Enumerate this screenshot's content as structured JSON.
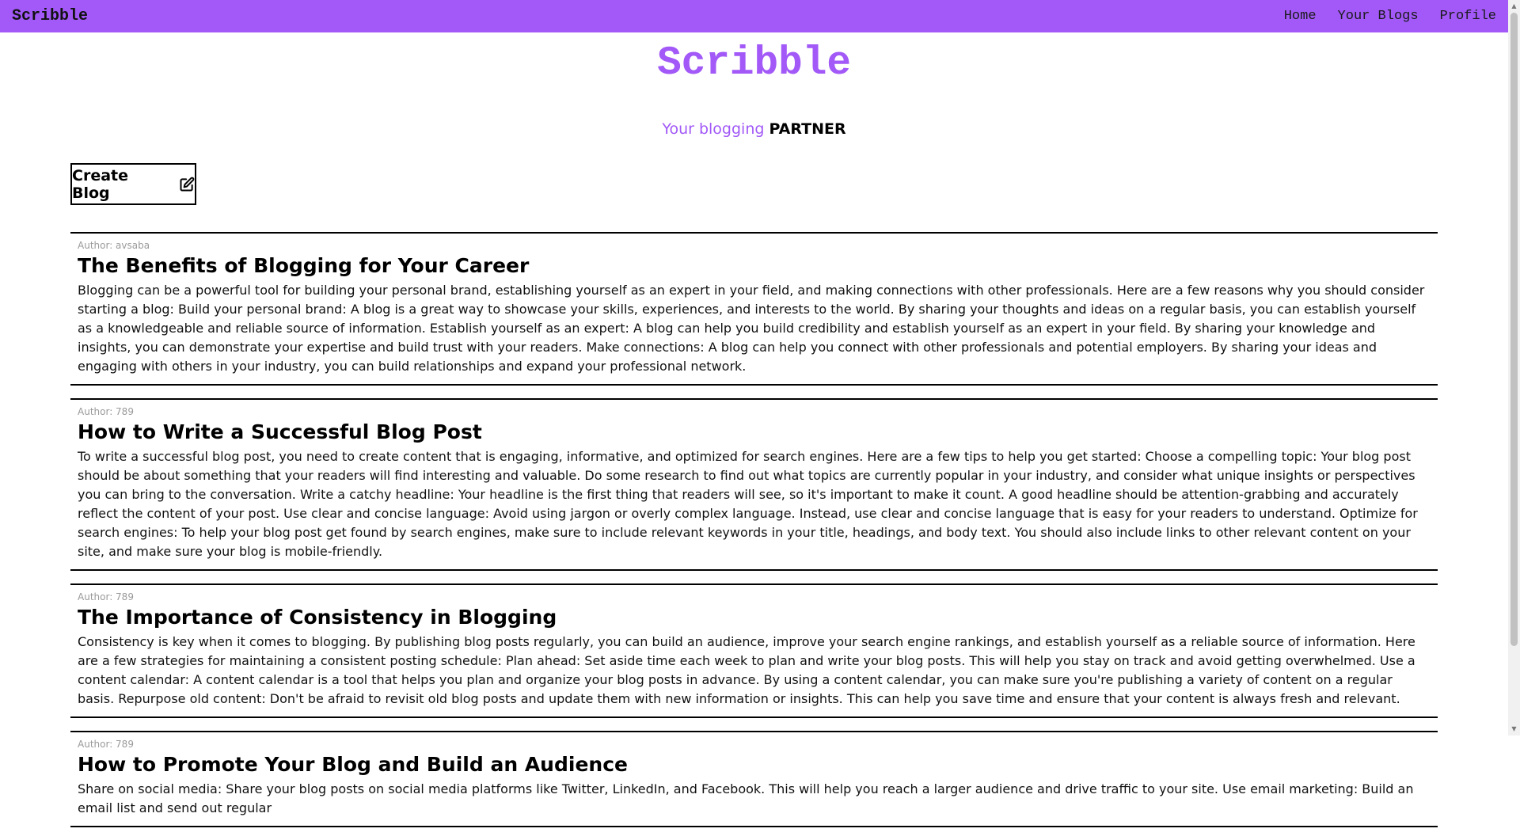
{
  "navbar": {
    "brand": "Scribble",
    "links": [
      {
        "label": "Home"
      },
      {
        "label": "Your Blogs"
      },
      {
        "label": "Profile"
      }
    ]
  },
  "hero": {
    "title": "Scribble",
    "tagline_light": "Your blogging",
    "tagline_strong": "PARTNER"
  },
  "create_button": {
    "label": "Create Blog",
    "icon": "edit-icon"
  },
  "blogs": [
    {
      "author": "Author: avsaba",
      "title": "The Benefits of Blogging for Your Career",
      "body": "Blogging can be a powerful tool for building your personal brand, establishing yourself as an expert in your field, and making connections with other professionals. Here are a few reasons why you should consider starting a blog: Build your personal brand: A blog is a great way to showcase your skills, experiences, and interests to the world. By sharing your thoughts and ideas on a regular basis, you can establish yourself as a knowledgeable and reliable source of information. Establish yourself as an expert: A blog can help you build credibility and establish yourself as an expert in your field. By sharing your knowledge and insights, you can demonstrate your expertise and build trust with your readers. Make connections: A blog can help you connect with other professionals and potential employers. By sharing your ideas and engaging with others in your industry, you can build relationships and expand your professional network."
    },
    {
      "author": "Author: 789",
      "title": "How to Write a Successful Blog Post",
      "body": "To write a successful blog post, you need to create content that is engaging, informative, and optimized for search engines. Here are a few tips to help you get started: Choose a compelling topic: Your blog post should be about something that your readers will find interesting and valuable. Do some research to find out what topics are currently popular in your industry, and consider what unique insights or perspectives you can bring to the conversation. Write a catchy headline: Your headline is the first thing that readers will see, so it's important to make it count. A good headline should be attention-grabbing and accurately reflect the content of your post. Use clear and concise language: Avoid using jargon or overly complex language. Instead, use clear and concise language that is easy for your readers to understand. Optimize for search engines: To help your blog post get found by search engines, make sure to include relevant keywords in your title, headings, and body text. You should also include links to other relevant content on your site, and make sure your blog is mobile-friendly."
    },
    {
      "author": "Author: 789",
      "title": "The Importance of Consistency in Blogging",
      "body": "Consistency is key when it comes to blogging. By publishing blog posts regularly, you can build an audience, improve your search engine rankings, and establish yourself as a reliable source of information. Here are a few strategies for maintaining a consistent posting schedule: Plan ahead: Set aside time each week to plan and write your blog posts. This will help you stay on track and avoid getting overwhelmed. Use a content calendar: A content calendar is a tool that helps you plan and organize your blog posts in advance. By using a content calendar, you can make sure you're publishing a variety of content on a regular basis. Repurpose old content: Don't be afraid to revisit old blog posts and update them with new information or insights. This can help you save time and ensure that your content is always fresh and relevant."
    },
    {
      "author": "Author: 789",
      "title": "How to Promote Your Blog and Build an Audience",
      "body": "Share on social media: Share your blog posts on social media platforms like Twitter, LinkedIn, and Facebook. This will help you reach a larger audience and drive traffic to your site. Use email marketing: Build an email list and send out regular"
    }
  ],
  "colors": {
    "accent": "#a259f7",
    "navbar_bg": "#a259f7"
  }
}
